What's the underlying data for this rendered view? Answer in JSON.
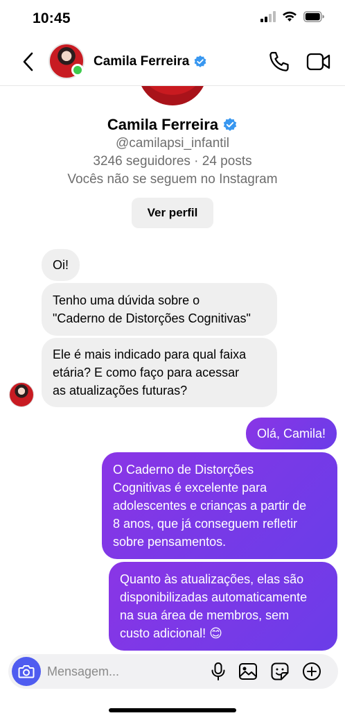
{
  "status_bar": {
    "time": "10:45",
    "icons": [
      "signal-icon",
      "wifi-icon",
      "battery-icon"
    ]
  },
  "header": {
    "contact_name": "Camila Ferreira",
    "verified": true,
    "icons": [
      "back-chevron-icon",
      "phone-icon",
      "video-icon"
    ]
  },
  "profile": {
    "name": "Camila Ferreira",
    "handle": "@camilapsi_infantil",
    "stats": "3246 seguidores · 24 posts",
    "follow_status": "Vocês não se seguem no Instagram",
    "view_profile_label": "Ver perfil"
  },
  "messages": {
    "incoming": [
      {
        "text": "Oi!"
      },
      {
        "lines": [
          "Tenho uma dúvida sobre o",
          "\"Caderno de Distorções Cognitivas\""
        ]
      },
      {
        "lines": [
          "Ele é mais indicado para qual faixa",
          "etária? E como faço para acessar",
          "as atualizações futuras?"
        ]
      }
    ],
    "outgoing": [
      {
        "text": "Olá, Camila!"
      },
      {
        "lines": [
          "O Caderno de Distorções",
          "Cognitivas é excelente para",
          "adolescentes e crianças a partir de",
          "8 anos, que já conseguem refletir",
          "sobre pensamentos."
        ]
      },
      {
        "lines": [
          "Quanto às atualizações, elas são",
          "disponibilizadas automaticamente",
          "na sua área de membros, sem",
          "custo adicional! 😊"
        ]
      }
    ]
  },
  "composer": {
    "placeholder": "Mensagem...",
    "icons": [
      "camera-icon",
      "microphone-icon",
      "gallery-icon",
      "sticker-icon",
      "plus-circle-icon"
    ]
  },
  "colors": {
    "accent_outgoing_start": "#8a35e6",
    "accent_outgoing_end": "#6a3de8",
    "incoming_bubble": "#efefef",
    "verified_blue": "#3897f0",
    "online_green": "#3ecb4d",
    "camera_button": "#4f5cf0"
  }
}
